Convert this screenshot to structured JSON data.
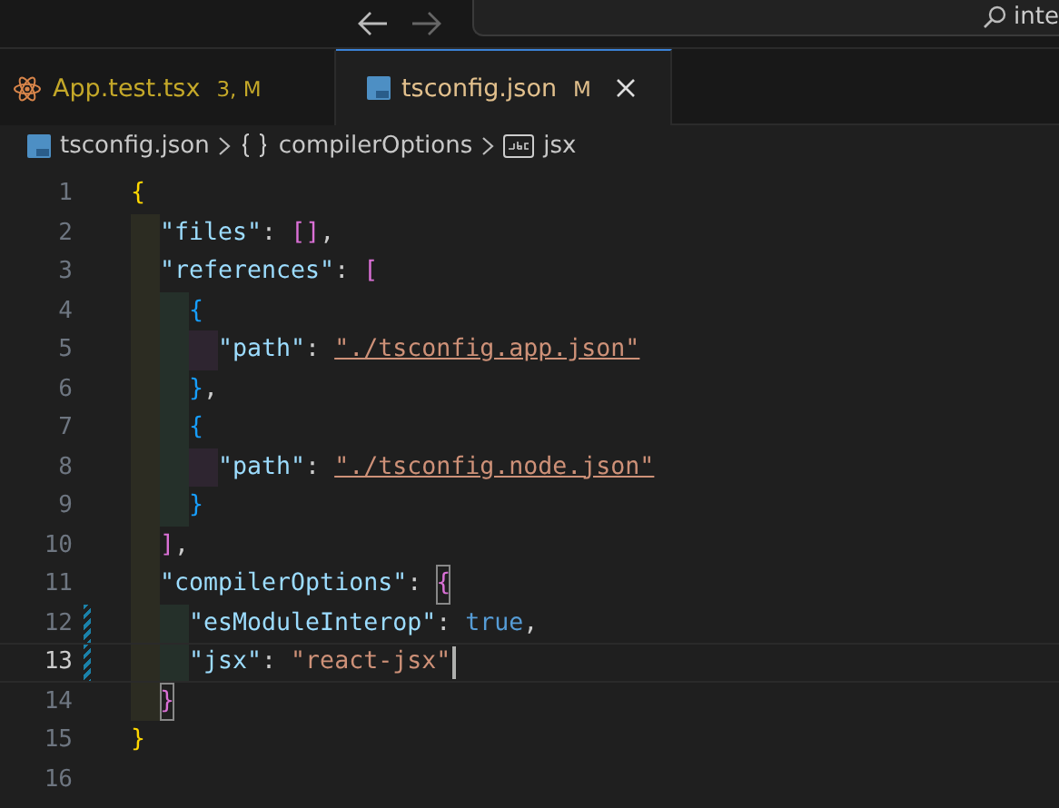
{
  "title_bar": {
    "search": {
      "value": "inte"
    }
  },
  "tabs": [
    {
      "label": "App.test.tsx",
      "badge": "3, M",
      "selected": false,
      "close": false
    },
    {
      "label": "tsconfig.json",
      "badge": "M",
      "selected": true,
      "close": true
    }
  ],
  "breadcrumbs": [
    {
      "label": "tsconfig.json"
    },
    {
      "label": "compilerOptions"
    },
    {
      "label": "jsx"
    }
  ],
  "editor": {
    "lines": [
      {
        "number": "1",
        "current": false,
        "modified": false,
        "tokens": [
          {
            "t": "{",
            "kind": "brace1"
          }
        ]
      },
      {
        "number": "2",
        "current": false,
        "modified": false,
        "tokens": [
          {
            "t": "\"files\"",
            "kind": "key"
          },
          {
            "t": ": ",
            "kind": "punct"
          },
          {
            "t": "[]",
            "kind": "brace2"
          },
          {
            "t": ",",
            "kind": "punct"
          }
        ]
      },
      {
        "number": "3",
        "current": false,
        "modified": false,
        "tokens": [
          {
            "t": "\"references\"",
            "kind": "key"
          },
          {
            "t": ": ",
            "kind": "punct"
          },
          {
            "t": "[",
            "kind": "brace2"
          }
        ]
      },
      {
        "number": "4",
        "current": false,
        "modified": false,
        "tokens": [
          {
            "t": "{",
            "kind": "brace3"
          }
        ]
      },
      {
        "number": "5",
        "current": false,
        "modified": false,
        "tokens": [
          {
            "t": "\"path\"",
            "kind": "key"
          },
          {
            "t": ": ",
            "kind": "punct"
          },
          {
            "t": "\"./tsconfig.app.json\"",
            "kind": "link"
          }
        ]
      },
      {
        "number": "6",
        "current": false,
        "modified": false,
        "tokens": [
          {
            "t": "}",
            "kind": "brace3"
          },
          {
            "t": ",",
            "kind": "punct"
          }
        ]
      },
      {
        "number": "7",
        "current": false,
        "modified": false,
        "tokens": [
          {
            "t": "{",
            "kind": "brace3"
          }
        ]
      },
      {
        "number": "8",
        "current": false,
        "modified": false,
        "tokens": [
          {
            "t": "\"path\"",
            "kind": "key"
          },
          {
            "t": ": ",
            "kind": "punct"
          },
          {
            "t": "\"./tsconfig.node.json\"",
            "kind": "link"
          }
        ]
      },
      {
        "number": "9",
        "current": false,
        "modified": false,
        "tokens": [
          {
            "t": "}",
            "kind": "brace3"
          }
        ]
      },
      {
        "number": "10",
        "current": false,
        "modified": false,
        "tokens": [
          {
            "t": "]",
            "kind": "brace2"
          },
          {
            "t": ",",
            "kind": "punct"
          }
        ]
      },
      {
        "number": "11",
        "current": false,
        "modified": false,
        "tokens": [
          {
            "t": "\"compilerOptions\"",
            "kind": "key"
          },
          {
            "t": ": ",
            "kind": "punct"
          },
          {
            "t": "{",
            "kind": "brace2",
            "matched": true
          }
        ]
      },
      {
        "number": "12",
        "current": false,
        "modified": true,
        "tokens": [
          {
            "t": "\"esModuleInterop\"",
            "kind": "key"
          },
          {
            "t": ": ",
            "kind": "punct"
          },
          {
            "t": "true",
            "kind": "bool"
          },
          {
            "t": ",",
            "kind": "punct"
          }
        ]
      },
      {
        "number": "13",
        "current": true,
        "modified": true,
        "tokens": [
          {
            "t": "\"jsx\"",
            "kind": "key"
          },
          {
            "t": ": ",
            "kind": "punct"
          },
          {
            "t": "\"react-jsx\"",
            "kind": "string"
          }
        ]
      },
      {
        "number": "14",
        "current": false,
        "modified": false,
        "tokens": [
          {
            "t": "}",
            "kind": "brace2",
            "matched": true
          }
        ]
      },
      {
        "number": "15",
        "current": false,
        "modified": false,
        "tokens": [
          {
            "t": "}",
            "kind": "brace1"
          }
        ]
      },
      {
        "number": "16",
        "current": false,
        "modified": false
      }
    ]
  }
}
